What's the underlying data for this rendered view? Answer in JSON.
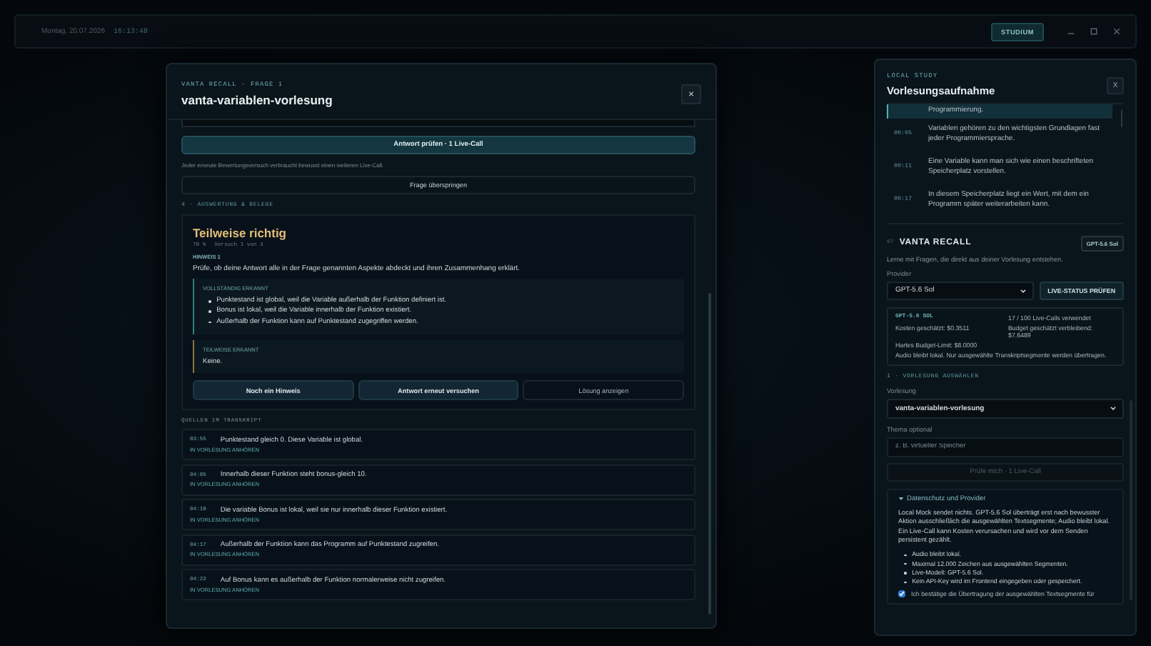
{
  "top_bar": {
    "date": "Montag, 20.07.2026",
    "time": "16:13:48",
    "mode_button": "STUDIUM"
  },
  "quiz_modal": {
    "eyebrow": "VANTA RECALL · FRAGE 1",
    "title": "vanta-variablen-vorlesung",
    "close_label": "×",
    "check_button": "Antwort prüfen · 1 Live-Call",
    "note": "Jeder erneute Bewertungsversuch verbraucht bewusst einen weiteren Live-Call.",
    "skip_button": "Frage überspringen",
    "section_label": "4 · AUSWERTUNG & BELEGE",
    "result": {
      "verdict": "Teilweise richtig",
      "score": "70 %",
      "attempt": "Versuch 1 von 3",
      "hint_label": "HINWEIS 1",
      "hint": "Prüfe, ob deine Antwort alle in der Frage genannten Aspekte abdeckt und ihren Zusammenhang erklärt.",
      "groups": [
        {
          "label": "VOLLSTÄNDIG ERKANNT",
          "kind": "list",
          "color": "#2f7f7c",
          "items": [
            "Punktestand ist global, weil die Variable außerhalb der Funktion definiert ist.",
            "Bonus ist lokal, weil die Variable innerhalb der Funktion existiert.",
            "Außerhalb der Funktion kann auf Punktestand zugegriffen werden."
          ]
        },
        {
          "label": "TEILWEISE ERKANNT",
          "kind": "text",
          "color": "#8a7440",
          "items": [
            "Keine."
          ]
        }
      ],
      "actions": [
        {
          "label": "Noch ein Hinweis",
          "kind": "filled"
        },
        {
          "label": "Antwort erneut versuchen",
          "kind": "filled"
        },
        {
          "label": "Lösung anzeigen",
          "kind": "outline"
        }
      ]
    },
    "sources_label": "QUELLEN IM TRANSKRIPT",
    "sources": [
      {
        "time": "03:55",
        "text": "Punktestand gleich 0. Diese Variable ist global.",
        "link": "IN VORLESUNG ANHÖREN"
      },
      {
        "time": "04:05",
        "text": "Innerhalb dieser Funktion steht bonus-gleich 10.",
        "link": "IN VORLESUNG ANHÖREN"
      },
      {
        "time": "04:10",
        "text": "Die variable Bonus ist lokal, weil sie nur innerhalb dieser Funktion existiert.",
        "link": "IN VORLESUNG ANHÖREN"
      },
      {
        "time": "04:17",
        "text": "Außerhalb der Funktion kann das Programm auf Punktestand zugreifen.",
        "link": "IN VORLESUNG ANHÖREN"
      },
      {
        "time": "04:22",
        "text": "Auf Bonus kann es außerhalb der Funktion normalerweise nicht zugreifen.",
        "link": "IN VORLESUNG ANHÖREN"
      }
    ]
  },
  "study_panel": {
    "eyebrow": "LOCAL STUDY",
    "title": "Vorlesungsaufnahme",
    "close_label": "X",
    "transcript": [
      {
        "text": "Programmierung.",
        "selected": true
      },
      {
        "time": "00:05",
        "text": "Variablen gehören zu den wichtigsten Grundlagen fast jeder Programmiersprache.",
        "selected": false
      },
      {
        "time": "00:11",
        "text": "Eine Variable kann man sich wie einen beschrifteten Speicherplatz vorstellen.",
        "selected": false
      },
      {
        "time": "00:17",
        "text": "In diesem Speicherplatz liegt ein Wert, mit dem ein Programm später weiterarbeiten kann.",
        "selected": false
      }
    ],
    "recall": {
      "number": "07",
      "title": "VANTA RECALL",
      "model_badge": "GPT-5.6 Sol",
      "intro": "Lerne mit Fragen, die direkt aus deiner Vorlesung entstehen.",
      "provider_label": "Provider",
      "provider_value": "GPT-5.6 Sol",
      "status_button": "LIVE-STATUS PRÜFEN",
      "stats": {
        "model": "GPT-5.6 SOL",
        "calls": "17 / 100 Live-Calls verwendet",
        "cost": "Kosten geschätzt: $0.3511",
        "budget": "Budget geschätzt verbleibend: $7.6489",
        "limit": "Hartes Budget-Limit: $8.0000",
        "audio_note": "Audio bleibt lokal. Nur ausgewählte Transkriptsegmente werden übertragen."
      },
      "section_label": "1 · VORLESUNG AUSWÄHLEN",
      "lecture_label": "Vorlesung",
      "lecture_value": "vanta-variablen-vorlesung",
      "topic_label": "Thema optional",
      "topic_placeholder": "z. B. virtueller Speicher",
      "quiz_button": {
        "label": "Prüfe mich · 1 Live-Call",
        "disabled": true
      },
      "privacy": {
        "summary": "Datenschutz und Provider",
        "expanded": true,
        "text": "Local Mock sendet nichts. GPT-5.6 Sol überträgt erst nach bewusster Aktion ausschließlich die ausgewählten Textsegmente; Audio bleibt lokal. Ein Live-Call kann Kosten verursachen und wird vor dem Senden persistent gezählt.",
        "items": [
          "Audio bleibt lokal.",
          "Maximal 12.000 Zeichen aus ausgewählten Segmenten.",
          "Live-Modell: GPT-5.6 Sol.",
          "Kein API-Key wird im Frontend eingegeben oder gespeichert."
        ],
        "consent": {
          "label": "Ich bestätige die Übertragung der ausgewählten Textsegmente für",
          "checked": true
        }
      }
    }
  }
}
